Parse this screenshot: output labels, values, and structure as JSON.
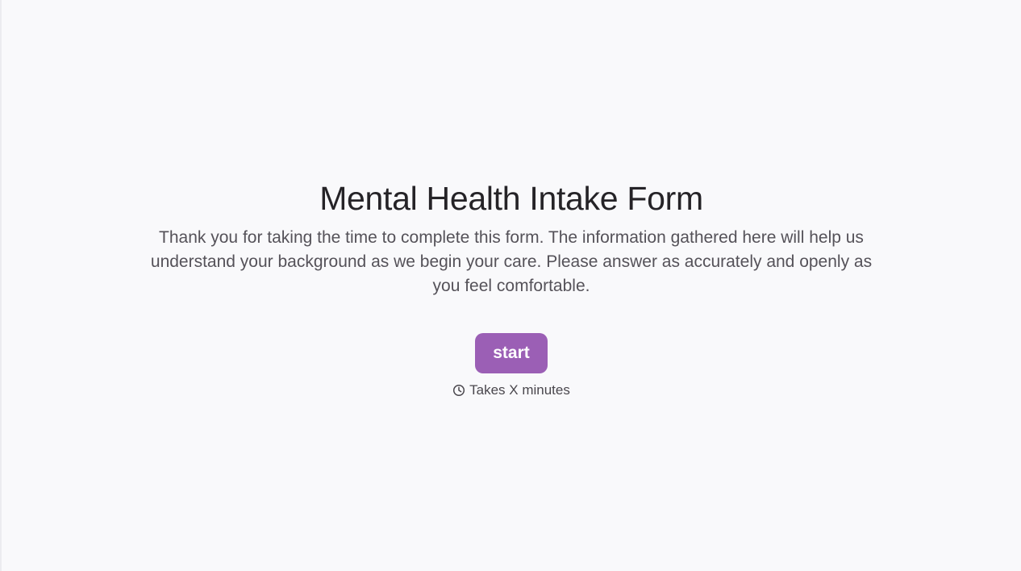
{
  "form": {
    "title": "Mental Health Intake Form",
    "intro": "Thank you for taking the time to complete this form. The information gathered here will help us understand your background as we begin your care. Please answer as accurately and openly as you feel comfortable.",
    "start_label": "start",
    "duration_icon": "clock-icon",
    "duration_text": "Takes X minutes"
  },
  "colors": {
    "background": "#f9f9fb",
    "accent": "#9b5fb5",
    "title": "#252327",
    "body_text": "#555259"
  }
}
